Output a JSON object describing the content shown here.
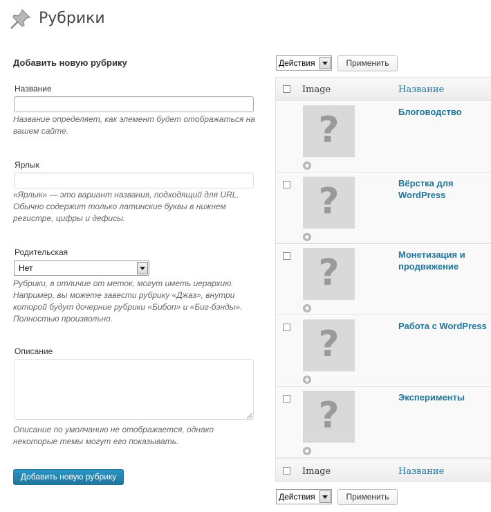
{
  "header": {
    "title": "Рубрики",
    "icon": "pushpin-icon"
  },
  "form": {
    "heading": "Добавить новую рубрику",
    "name_label": "Название",
    "name_value": "",
    "name_help": "Название определяет, как элемент будет отображаться на вашем сайте.",
    "slug_label": "Ярлык",
    "slug_value": "",
    "slug_help": "«Ярлык» — это вариант названия, подходящий для URL. Обычно содержит только латинские буквы в нижнем регистре, цифры и дефисы.",
    "parent_label": "Родительская",
    "parent_value": "Нет",
    "parent_help": "Рубрики, в отличие от меток, могут иметь иерархию. Например, вы можете завести рубрику «Джаз», внутри которой будут дочерние рубрики «Бибоп» и «Биг-бэнды». Полностью произвольно.",
    "description_label": "Описание",
    "description_value": "",
    "description_help": "Описание по умолчанию не отображается, однако некоторые темы могут его показывать.",
    "submit_label": "Добавить новую рубрику"
  },
  "bulk_top": {
    "action": "Действия",
    "apply": "Применить"
  },
  "bulk_bottom": {
    "action": "Действия",
    "apply": "Применить"
  },
  "table": {
    "columns": {
      "image": "Image",
      "name": "Название"
    },
    "rows": [
      {
        "name": "Блоговодство",
        "image": "?"
      },
      {
        "name": "Вёрстка для WordPress",
        "image": "?"
      },
      {
        "name": "Монетизация и продвижение",
        "image": "?"
      },
      {
        "name": "Работа с WordPress",
        "image": "?"
      },
      {
        "name": "Эксперименты",
        "image": "?"
      }
    ]
  },
  "colors": {
    "link": "#21759b",
    "primary_button": "#21759b",
    "placeholder_image": "#d9d9d9"
  }
}
